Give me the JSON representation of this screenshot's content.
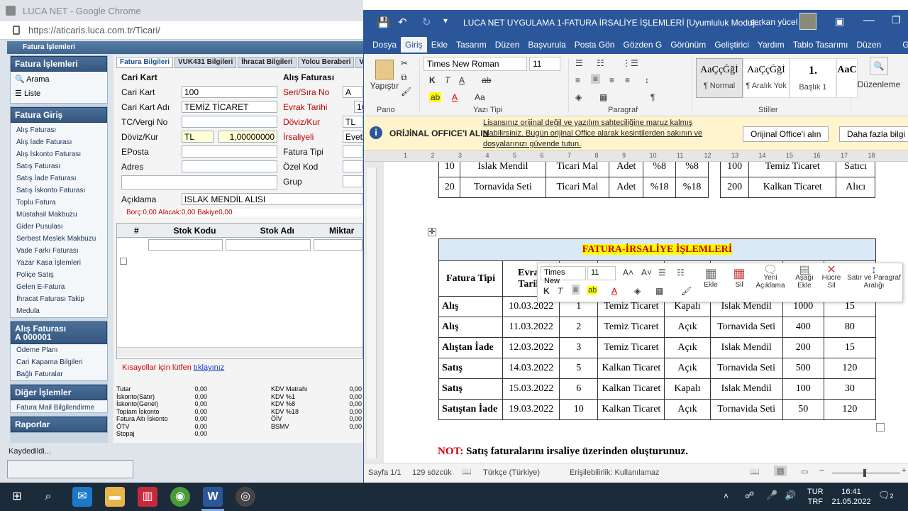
{
  "chrome": {
    "title": "LUCA NET - Google Chrome",
    "url": "https://aticaris.luca.com.tr/Ticari/",
    "app_title": "Fatura İşlemleri",
    "status": "Kaydedildi..."
  },
  "sidebar": {
    "fatura_islemleri": {
      "title": "Fatura İşlemleri",
      "items": [
        "Arama",
        "Liste"
      ]
    },
    "fatura_giris": {
      "title": "Fatura Giriş",
      "items": [
        "Alış Faturası",
        "Alış İade Faturası",
        "Alış İskonto Faturası",
        "Satış Faturası",
        "Satış İade Faturası",
        "Satış İskonto Faturası",
        "Toplu Fatura",
        "Müstahsil Makbuzu",
        "Gider Pusulası",
        "Serbest Meslek Makbuzu",
        "Vade Farkı Faturası",
        "Yazar Kasa İşlemleri",
        "Poliçe Satış",
        "Gelen E-Fatura",
        "İhracat Faturası Takip",
        "Medula"
      ]
    },
    "alis_faturasi": {
      "title": "Alış Faturası",
      "subtitle": "A 000001",
      "items": [
        "Ödeme Planı",
        "Cari Kapama Bilgileri",
        "Bağlı Faturalar"
      ]
    },
    "diger": {
      "title": "Diğer İşlemler",
      "items": [
        "Fatura Mail Bilgilendirme"
      ]
    },
    "raporlar": {
      "title": "Raporlar"
    }
  },
  "form": {
    "tabs": [
      "Fatura Bilgileri",
      "VUK431 Bilgileri",
      "İhracat Bilgileri",
      "Yolcu Beraberi",
      "V"
    ],
    "cari_kart_heading": "Cari Kart",
    "alis_faturasi_heading": "Alış Faturası",
    "labels": {
      "cari_kart": "Cari Kart",
      "cari_kart_adi": "Cari Kart Adı",
      "tc": "TC/Vergi No",
      "doviz": "Döviz/Kur",
      "eposta": "EPosta",
      "adres": "Adres",
      "aciklama": "Açıklama",
      "seri": "Seri/Sıra No",
      "evrak": "Evrak Tarihi",
      "doviz_kur": "Döviz/Kur",
      "irsaliyeli": "İrsaliyeli",
      "fatura_tipi": "Fatura Tipi",
      "ozel_kod": "Özel Kod",
      "grup": "Grup"
    },
    "values": {
      "cari_kart": "100",
      "cari_kart_adi": "TEMİZ TİCARET",
      "doviz": "TL",
      "kur": "1,00000000",
      "aciklama": "ISLAK MENDİL ALISI",
      "seri": "A",
      "evrak": "10",
      "doviz2": "TL",
      "irsaliyeli": "Evet"
    },
    "balance": "Borç:0,00   Alacak:0,00   Bakiye0,00",
    "grid_headers": [
      "#",
      "Stok Kodu",
      "Stok Adı",
      "Miktar"
    ],
    "shortcut_text": "Kısayollar için lütfen",
    "shortcut_link": "tıklayınız",
    "totals_left": [
      [
        "Tutar",
        "0,00"
      ],
      [
        "İskonto(Satır)",
        "0,00"
      ],
      [
        "İskonto(Genel)",
        "0,00"
      ],
      [
        "Toplam İskonto",
        "0,00"
      ],
      [
        "Fatura Altı İskonto",
        "0,00"
      ],
      [
        "ÖTV",
        "0,00"
      ],
      [
        "Stopaj",
        "0,00"
      ]
    ],
    "totals_right": [
      [
        "KDV Matrahı",
        "0,00"
      ],
      [
        "KDV %1",
        "0,00"
      ],
      [
        "KDV %8",
        "0,00"
      ],
      [
        "KDV %18",
        "0,00"
      ],
      [
        "ÖİV",
        "0,00"
      ],
      [
        "BSMV",
        "0,00"
      ]
    ]
  },
  "word": {
    "title": "LUCA NET UYGULAMA 1-FATURA İRSALİYE İŞLEMLERİ [Uyumluluk Modu]...",
    "user": "serkan yücel",
    "tabs": [
      "Dosya",
      "Giriş",
      "Ekle",
      "Tasarım",
      "Düzen",
      "Başvurula",
      "Posta Gön",
      "Gözden G",
      "Görünüm",
      "Geliştirici",
      "Yardım",
      "Tablo Tasarımı",
      "Düzen",
      "Göster"
    ],
    "font_name": "Times New Roman",
    "font_size": "11",
    "paste_label": "Yapıştır",
    "groups": [
      "Pano",
      "Yazı Tipi",
      "Paragraf",
      "Stiller",
      "Düzenleme"
    ],
    "styles": [
      {
        "preview": "AaÇçĞğİ",
        "name": "¶ Normal"
      },
      {
        "preview": "AaÇçĞğİ",
        "name": "¶ Aralık Yok"
      },
      {
        "preview": "1.",
        "name": "Başlık 1"
      },
      {
        "preview": "AaC",
        "name": ""
      }
    ],
    "editing_label": "Düzenleme",
    "message": {
      "title": "ORİJİNAL OFFICE'I ALIN",
      "text": "Lisansınız orijinal değil ve yazılım sahteciliğine maruz kalmış olabilirsiniz. Bugün orijinal Office alarak kesintilerden sakının ve dosyalarınızı güvende tutun.",
      "btn1": "Orijinal Office'i alın",
      "btn2": "Daha fazla bilgi"
    },
    "ruler_marks": [
      "1",
      "2",
      "3",
      "4",
      "5",
      "6",
      "7",
      "8",
      "9",
      "10",
      "11",
      "12",
      "13",
      "14",
      "15",
      "16",
      "17",
      "18"
    ],
    "top_table": [
      [
        "10",
        "Islak Mendil",
        "Ticari Mal",
        "Adet",
        "%8",
        "%8"
      ],
      [
        "20",
        "Tornavida Seti",
        "Ticari Mal",
        "Adet",
        "%18",
        "%18"
      ]
    ],
    "side_table": [
      [
        "100",
        "Temiz Ticaret",
        "Satıcı"
      ],
      [
        "200",
        "Kalkan Ticaret",
        "Alıcı"
      ]
    ],
    "main_title": "FATURA-İRSALİYE İŞLEMLERİ",
    "main_headers": [
      "Fatura Tipi",
      "Evrak Tarihi",
      "",
      "",
      "",
      "",
      "",
      ""
    ],
    "main_rows": [
      [
        "Alış",
        "10.03.2022",
        "1",
        "Temiz Ticaret",
        "Kapalı",
        "Islak Mendil",
        "1000",
        "15"
      ],
      [
        "Alış",
        "11.03.2022",
        "2",
        "Temiz Ticaret",
        "Açık",
        "Tornavida Seti",
        "400",
        "80"
      ],
      [
        "Alıştan İade",
        "12.03.2022",
        "3",
        "Temiz Ticaret",
        "Açık",
        "Islak Mendil",
        "200",
        "15"
      ],
      [
        "Satış",
        "14.03.2022",
        "5",
        "Kalkan Ticaret",
        "Açık",
        "Tornavida Seti",
        "500",
        "120"
      ],
      [
        "Satış",
        "15.03.2022",
        "6",
        "Kalkan Ticaret",
        "Kapalı",
        "Islak Mendil",
        "100",
        "30"
      ],
      [
        "Satıştan İade",
        "19.03.2022",
        "10",
        "Kalkan Ticaret",
        "Açık",
        "Tornavida Seti",
        "50",
        "120"
      ]
    ],
    "note_label": "NOT:",
    "note_text": "Satış faturalarını irsaliye üzerinden oluşturunuz.",
    "mini": {
      "font": "Times New",
      "size": "11",
      "btn_ekle": "Ekle",
      "btn_sil": "Sil",
      "btn_yeni": "Yeni Açıklama",
      "btn_asagi": "Aşağı Ekle",
      "btn_hucre": "Hücre Sil",
      "btn_satir": "Satır ve Paragraf Aralığı"
    },
    "status": {
      "page": "Sayfa 1/1",
      "words": "129 sözcük",
      "lang": "Türkçe (Türkiye)",
      "access": "Erişilebilirlik: Kullanılamaz"
    }
  },
  "taskbar": {
    "lang1": "TUR",
    "lang2": "TRF",
    "time": "16:41",
    "date": "21.05.2022",
    "notif": "2"
  }
}
